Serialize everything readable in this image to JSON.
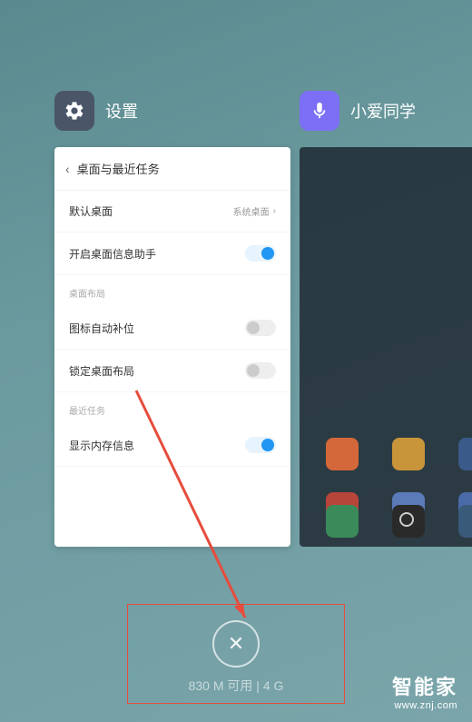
{
  "apps": {
    "settings": {
      "title": "设置",
      "page_title": "桌面与最近任务",
      "rows": {
        "default_launcher": {
          "label": "默认桌面",
          "value": "系统桌面"
        },
        "info_assistant": {
          "label": "开启桌面信息助手"
        },
        "section_layout": "桌面布局",
        "auto_fill": {
          "label": "图标自动补位"
        },
        "lock_layout": {
          "label": "锁定桌面布局"
        },
        "section_recents": "最近任务",
        "show_memory": {
          "label": "显示内存信息"
        }
      }
    },
    "xiaoai": {
      "title": "小爱同学"
    }
  },
  "memory": {
    "available": "830 M 可用",
    "total": "4 G"
  },
  "watermark": {
    "title": "智能家",
    "url": "www.znj.com"
  }
}
